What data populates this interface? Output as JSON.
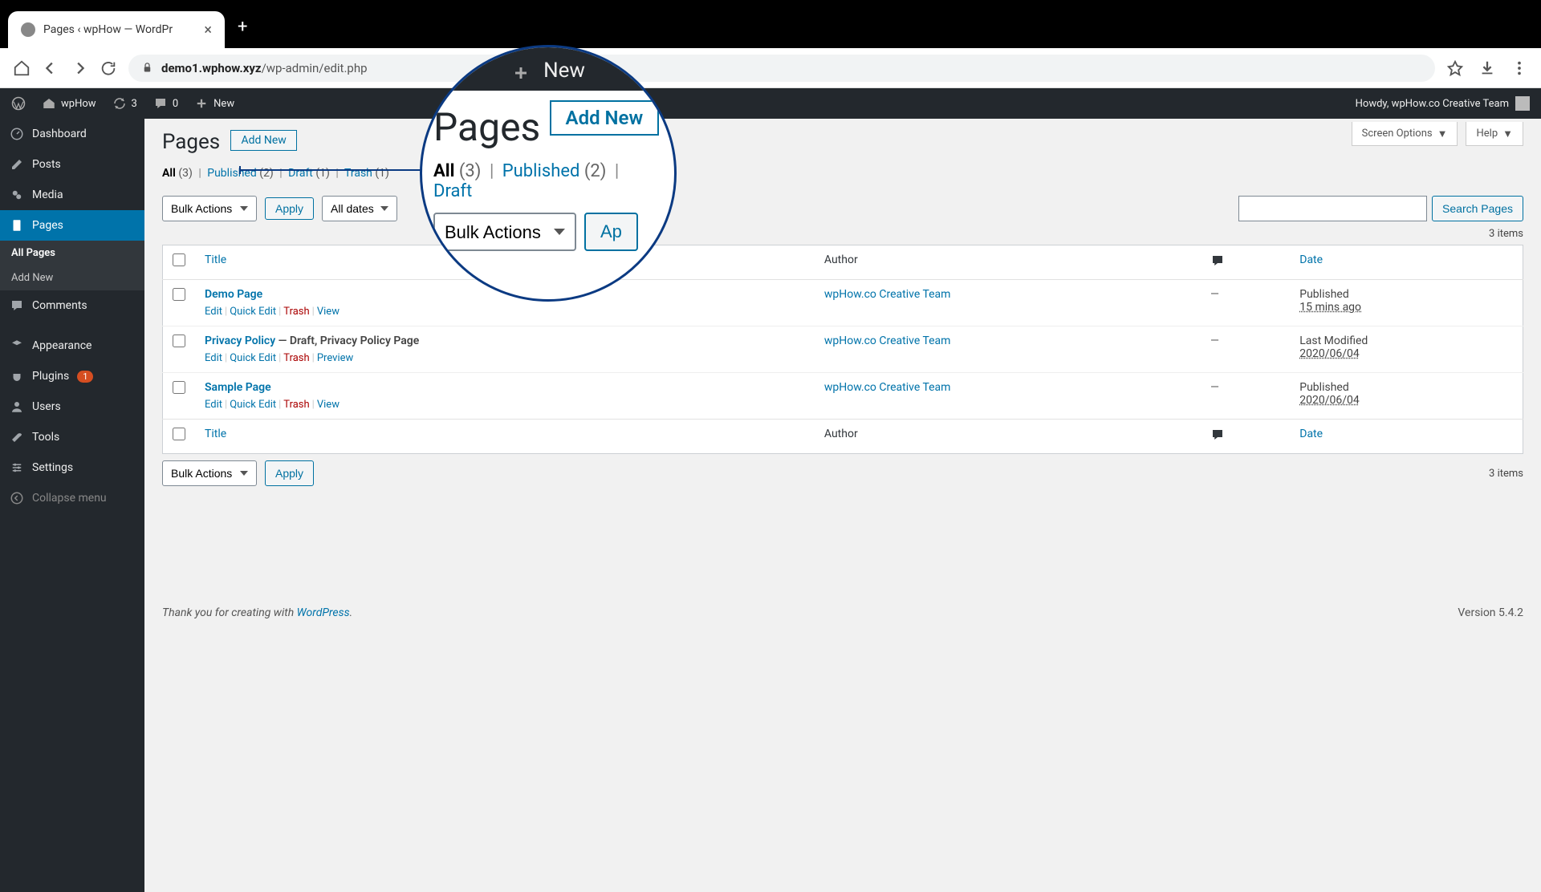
{
  "browser": {
    "tab_title": "Pages ‹ wpHow — WordPr",
    "url_host": "demo1.wphow.xyz",
    "url_path": "/wp-admin/edit.php"
  },
  "adminbar": {
    "site": "wpHow",
    "updates": "3",
    "comments": "0",
    "new": "New",
    "howdy": "Howdy, wpHow.co Creative Team"
  },
  "sidebar": {
    "dashboard": "Dashboard",
    "posts": "Posts",
    "media": "Media",
    "pages": "Pages",
    "all_pages": "All Pages",
    "add_new": "Add New",
    "comments": "Comments",
    "appearance": "Appearance",
    "plugins": "Plugins",
    "plugins_badge": "1",
    "users": "Users",
    "tools": "Tools",
    "settings": "Settings",
    "collapse": "Collapse menu"
  },
  "content": {
    "screen_options": "Screen Options",
    "help": "Help",
    "heading": "Pages",
    "add_new": "Add New",
    "filters": {
      "all": "All",
      "all_cnt": "(3)",
      "published": "Published",
      "published_cnt": "(2)",
      "draft": "Draft",
      "draft_cnt": "(1)",
      "trash": "Trash",
      "trash_cnt": "(1)"
    },
    "bulk": "Bulk Actions",
    "dates": "All dates",
    "apply": "Apply",
    "search_btn": "Search Pages",
    "items_count": "3 items",
    "cols": {
      "title": "Title",
      "author": "Author",
      "date": "Date"
    },
    "rows": [
      {
        "title": "Demo Page",
        "meta": "",
        "author": "wpHow.co Creative Team",
        "comment": "—",
        "date_l1": "Published",
        "date_l2": "15 mins ago",
        "actions": [
          "Edit",
          "Quick Edit",
          "Trash",
          "View"
        ]
      },
      {
        "title": "Privacy Policy",
        "meta": " — Draft, Privacy Policy Page",
        "author": "wpHow.co Creative Team",
        "comment": "—",
        "date_l1": "Last Modified",
        "date_l2": "2020/06/04",
        "actions": [
          "Edit",
          "Quick Edit",
          "Trash",
          "Preview"
        ]
      },
      {
        "title": "Sample Page",
        "meta": "",
        "author": "wpHow.co Creative Team",
        "comment": "—",
        "date_l1": "Published",
        "date_l2": "2020/06/04",
        "actions": [
          "Edit",
          "Quick Edit",
          "Trash",
          "View"
        ]
      }
    ],
    "footer_thank": "Thank you for creating with ",
    "footer_wp": "WordPress",
    "footer_dot": ".",
    "version": "Version 5.4.2"
  },
  "magnifier": {
    "new": "New",
    "heading": "Pages",
    "add_new": "Add New",
    "all": "All",
    "all_cnt": "(3)",
    "published": "Published",
    "published_cnt": "(2)",
    "draft": "Draft",
    "bulk": "Bulk Actions",
    "apply": "Ap"
  }
}
